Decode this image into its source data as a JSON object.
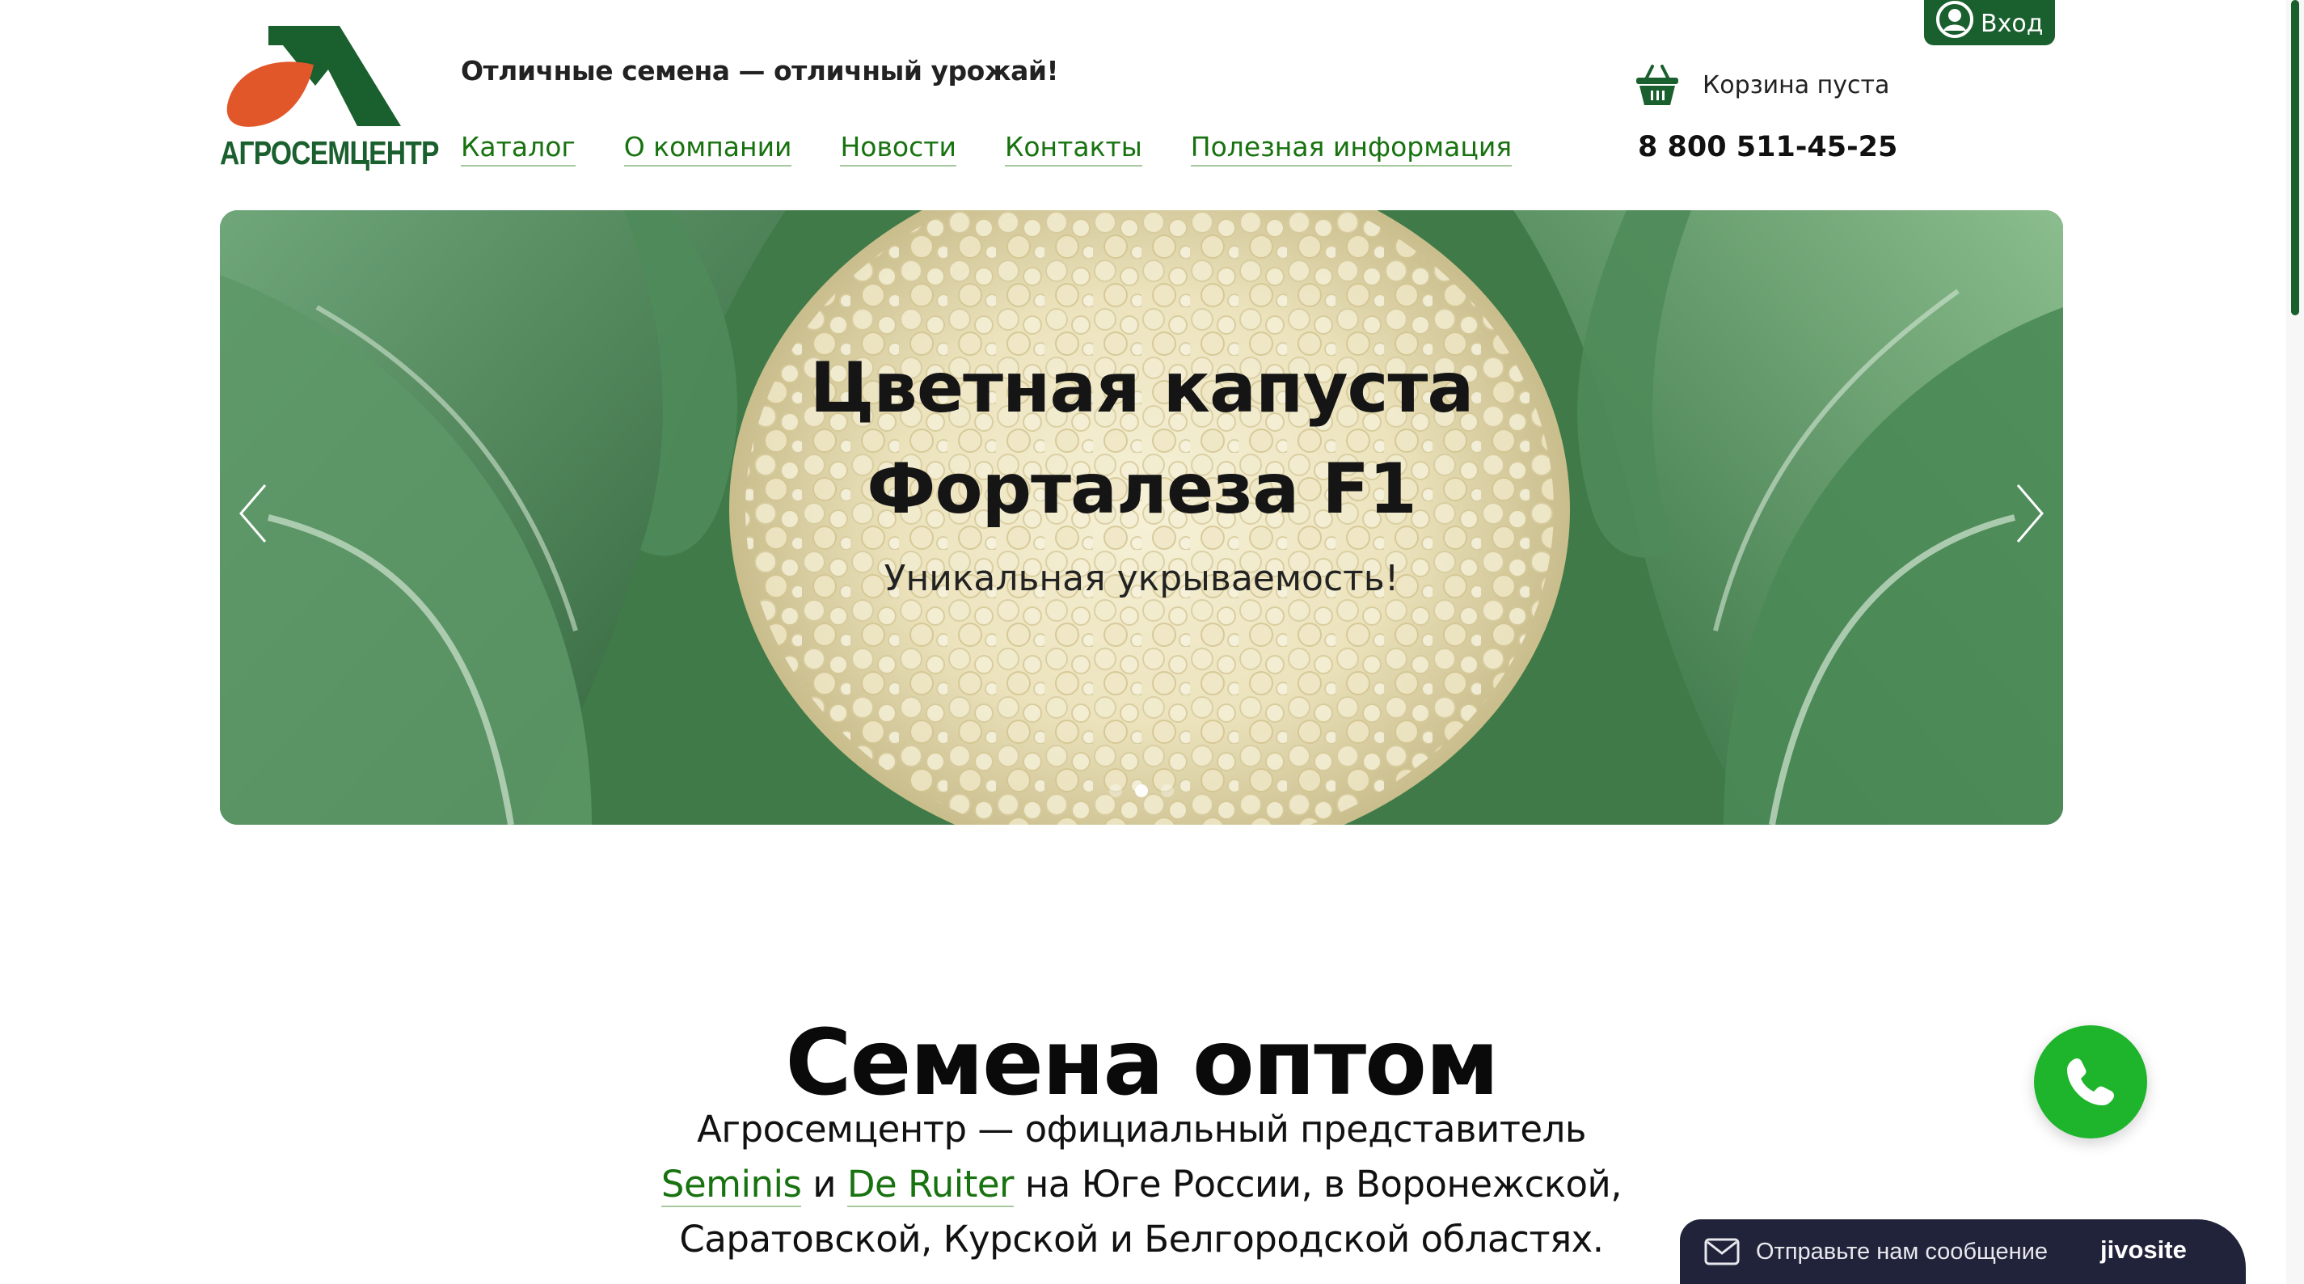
{
  "header": {
    "logo_text": "АГРОСЕМЦЕНТР",
    "tagline": "Отличные семена — отличный урожай!",
    "nav": [
      {
        "label": "Каталог"
      },
      {
        "label": "О компании"
      },
      {
        "label": "Новости"
      },
      {
        "label": "Контакты"
      },
      {
        "label": "Полезная информация"
      }
    ],
    "cart_label": "Корзина пуста",
    "phone": "8 800 511-45-25",
    "login_label": "Вход"
  },
  "slider": {
    "title_line1": "Цветная капуста",
    "title_line2": "Форталеза F1",
    "subtitle": "Уникальная укрываемость!",
    "slide_count": 3,
    "active_slide": 2
  },
  "main": {
    "heading": "Семена оптом",
    "intro_line1": "Агросемцентр — официальный представитель",
    "link_seminis": "Seminis",
    "word_and": " и ",
    "link_deruiter": "De Ruiter",
    "intro_line2_rest": " на Юге России, в Воронежской,",
    "intro_line3": "Саратовской, Курской и Белгородской областях."
  },
  "widgets": {
    "chat_label": "Отправьте нам сообщение",
    "chat_brand": "jivosite"
  },
  "colors": {
    "brand_green": "#1a5f2e",
    "link_green": "#17720f",
    "call_green": "#1eb52c",
    "logo_orange": "#e2572a",
    "chat_dark": "#21233a"
  },
  "icons": {
    "cart": "basket-icon",
    "login": "user-icon",
    "call": "phone-icon",
    "chat": "mail-icon",
    "prev": "chevron-left-icon",
    "next": "chevron-right-icon"
  }
}
